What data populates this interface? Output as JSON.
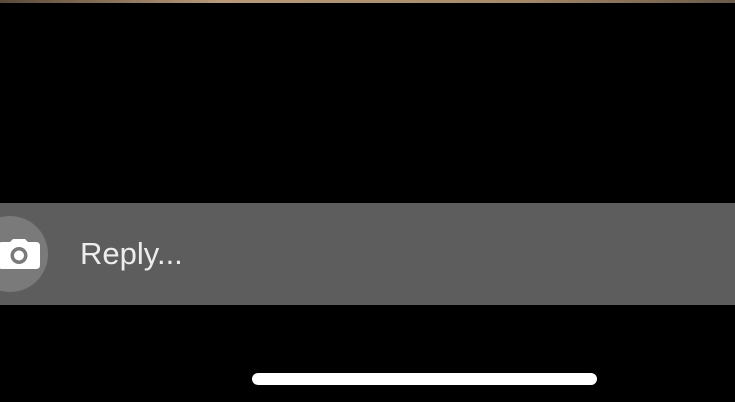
{
  "reply_bar": {
    "camera_icon": "camera-icon",
    "input_placeholder": "Reply...",
    "input_value": ""
  },
  "home_indicator": {
    "icon": "home-indicator-bar"
  },
  "colors": {
    "background": "#000000",
    "reply_bar": "#5d5d5d",
    "camera_button": "#7a7a7a",
    "text": "#ededed",
    "home_indicator": "#ffffff"
  }
}
